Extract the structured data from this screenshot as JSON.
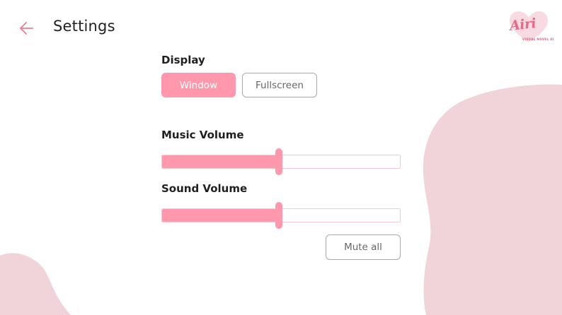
{
  "header": {
    "back_icon": "arrow-left-icon",
    "title": "Settings"
  },
  "logo": {
    "name": "Airi",
    "subtitle": "VISUAL NOVEL UI"
  },
  "display": {
    "label": "Display",
    "options": [
      "Window",
      "Fullscreen"
    ],
    "selected": "Window"
  },
  "music": {
    "label": "Music Volume",
    "value": 0.49
  },
  "sound": {
    "label": "Sound Volume",
    "value": 0.49
  },
  "mute_button": {
    "label": "Mute all"
  },
  "colors": {
    "accent": "#ff98ac",
    "blob": "#f1d4da",
    "track_border": "#f7c8d2",
    "button_border": "#a8a8a8"
  }
}
